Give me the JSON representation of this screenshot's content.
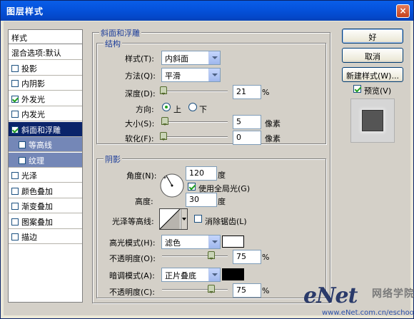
{
  "window": {
    "title": "图层样式",
    "close_glyph": "×"
  },
  "style_list": {
    "header": "样式",
    "items": [
      {
        "label": "混合选项:默认",
        "checkbox": false,
        "checked": false
      },
      {
        "label": "投影",
        "checkbox": true,
        "checked": false
      },
      {
        "label": "内阴影",
        "checkbox": true,
        "checked": false
      },
      {
        "label": "外发光",
        "checkbox": true,
        "checked": true
      },
      {
        "label": "内发光",
        "checkbox": true,
        "checked": false
      },
      {
        "label": "斜面和浮雕",
        "checkbox": true,
        "checked": true,
        "selected": true
      },
      {
        "label": "等高线",
        "checkbox": true,
        "checked": false,
        "sub": true
      },
      {
        "label": "纹理",
        "checkbox": true,
        "checked": false,
        "sub": true
      },
      {
        "label": "光泽",
        "checkbox": true,
        "checked": false
      },
      {
        "label": "颜色叠加",
        "checkbox": true,
        "checked": false
      },
      {
        "label": "渐变叠加",
        "checkbox": true,
        "checked": false
      },
      {
        "label": "图案叠加",
        "checkbox": true,
        "checked": false
      },
      {
        "label": "描边",
        "checkbox": true,
        "checked": false
      }
    ]
  },
  "bevel": {
    "group_title": "斜面和浮雕",
    "structure": {
      "title": "结构",
      "style_label": "样式(T):",
      "style_value": "内斜面",
      "technique_label": "方法(Q):",
      "technique_value": "平滑",
      "depth_label": "深度(D):",
      "depth_value": "21",
      "depth_unit": "%",
      "depth_fraction": 0.021,
      "direction_label": "方向:",
      "direction_up": "上",
      "direction_down": "下",
      "direction_selected": "上",
      "size_label": "大小(S):",
      "size_value": "5",
      "size_unit": "像素",
      "soften_label": "软化(F):",
      "soften_value": "0",
      "soften_unit": "像素"
    },
    "shading": {
      "title": "阴影",
      "angle_label": "角度(N):",
      "angle_value": "120",
      "angle_unit": "度",
      "global_light_label": "使用全局光(G)",
      "global_light_checked": true,
      "altitude_label": "高度:",
      "altitude_value": "30",
      "altitude_unit": "度",
      "gloss_contour_label": "光泽等高线:",
      "anti_aliased_label": "消除锯齿(L)",
      "anti_aliased_checked": false,
      "highlight_mode_label": "高光模式(H):",
      "highlight_mode_value": "滤色",
      "highlight_color": "#ffffff",
      "highlight_opacity_label": "不透明度(O):",
      "highlight_opacity_value": "75",
      "highlight_opacity_unit": "%",
      "shadow_mode_label": "暗调模式(A):",
      "shadow_mode_value": "正片叠底",
      "shadow_color": "#000000",
      "shadow_opacity_label": "不透明度(C):",
      "shadow_opacity_value": "75",
      "shadow_opacity_unit": "%"
    }
  },
  "buttons": {
    "ok": "好",
    "cancel": "取消",
    "new_style": "新建样式(W)...",
    "preview_label": "预览(V)",
    "preview_checked": true
  },
  "watermark": {
    "brand": "eNet",
    "brand_cn": "网络学院",
    "url": "www.eNet.com.cn/eschool"
  }
}
